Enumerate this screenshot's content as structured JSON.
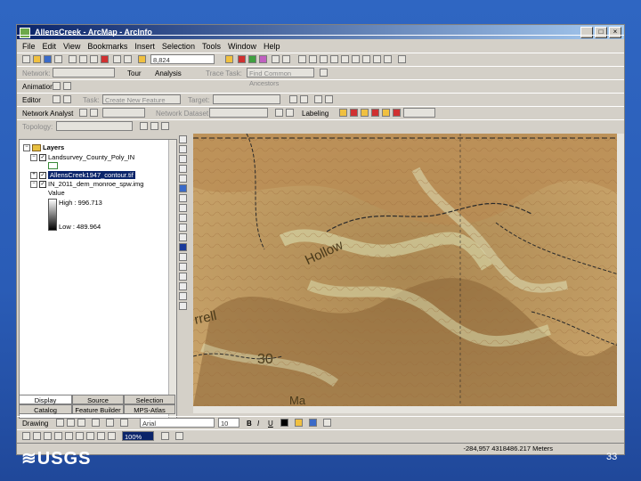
{
  "window": {
    "title": "AllensCreek - ArcMap - ArcInfo",
    "controls": [
      "_",
      "□",
      "×"
    ]
  },
  "menu": [
    "File",
    "Edit",
    "View",
    "Bookmarks",
    "Insert",
    "Selection",
    "Tools",
    "Window",
    "Help"
  ],
  "toolbar1": {
    "scale": "8,824"
  },
  "toolbar2": {
    "network_label": "Network:",
    "tour_label": "Tour",
    "analysis_label": "Analysis",
    "trace_task_label": "Trace Task:",
    "trace_task_value": "Find Common Ancestors"
  },
  "toolbar3": {
    "animation_label": "Animation"
  },
  "toolbar4": {
    "editor_label": "Editor",
    "task_label": "Task:",
    "task_value": "Create New Feature",
    "target_label": "Target:"
  },
  "toolbar5": {
    "network_analyst_label": "Network Analyst",
    "network_dataset_label": "Network Dataset",
    "labeling_label": "Labeling"
  },
  "toolbar6": {
    "topology_label": "Topology:"
  },
  "toc": {
    "layers_label": "Layers",
    "layer1": "Landsurvey_County_Poly_IN",
    "layer2": "AllensCreek1947_contour.tif",
    "layer3": "IN_2011_dem_monroe_spw.img",
    "value_label": "Value",
    "high_label": "High : 996.713",
    "low_label": "Low : 489.964"
  },
  "tabs_top": [
    "Display",
    "Source",
    "Selection"
  ],
  "tabs_bottom": [
    "Catalog",
    "Feature Builder",
    "MPS-Atlas"
  ],
  "drawing": {
    "drawing_label": "Drawing",
    "font": "Arial",
    "size": "10",
    "zoom": "100%"
  },
  "status": {
    "coords": "-284,957  4318486.217 Meters"
  },
  "map_labels": {
    "hollow": "Hollow",
    "ferrell": "rrell",
    "thirty": "30",
    "bottom": "Ma"
  },
  "footer": {
    "logo": "USGS",
    "page": "33"
  }
}
